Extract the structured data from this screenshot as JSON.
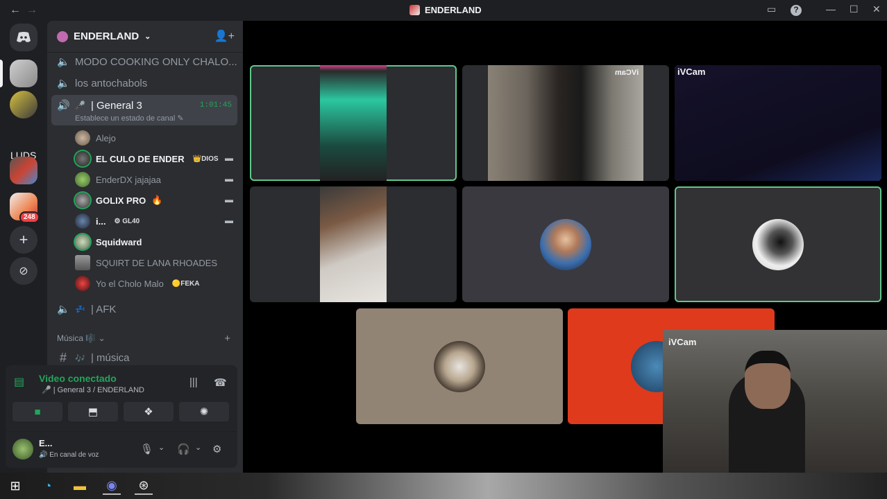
{
  "window": {
    "title": "ENDERLAND",
    "back_icon": "arrow-left-icon",
    "forward_icon": "arrow-right-icon"
  },
  "rail": {
    "text_server": "LUDS",
    "badge": "248"
  },
  "sidebar": {
    "server_name": "ENDERLAND",
    "channels": [
      {
        "name": "MODO COOKING ONLY CHALO..."
      },
      {
        "name": "los antochabols"
      }
    ],
    "active_channel": {
      "name": "| General 3",
      "timer": "1:01:45",
      "status": "Establece un estado de canal"
    },
    "members": [
      {
        "name": "Alejo"
      },
      {
        "name": "EL CULO DE ENDER",
        "tag": "DIOS"
      },
      {
        "name": "EnderDX jajajaa"
      },
      {
        "name": "GOLIX PRO"
      },
      {
        "name": "i...",
        "tag": "GL40"
      },
      {
        "name": "Squidward"
      },
      {
        "name": "SQUIRT DE LANA RHOADES"
      },
      {
        "name": "Yo el Cholo Malo",
        "tag": "FEKA"
      }
    ],
    "afk_channel": "| AFK",
    "category": "Música",
    "music_channel": "| música"
  },
  "voice_panel": {
    "title": "Video conectado",
    "subtitle": "General 3 / ENDERLAND",
    "user_name": "E...",
    "user_state": "En canal de voz"
  },
  "stage": {
    "tile_labels": [
      "iVCam",
      "iVCam"
    ],
    "mirrored_label": "iVCam",
    "pip_label": "iVCam"
  },
  "colors": {
    "speaking": "#23a55a",
    "accent_bg": "#2b2d31",
    "notification": "#f23f43"
  }
}
